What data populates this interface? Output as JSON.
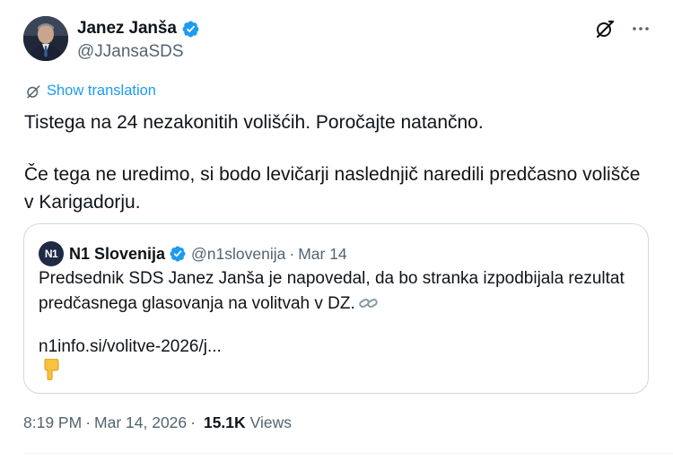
{
  "author": {
    "display_name": "Janez Janša",
    "handle": "@JJansaSDS"
  },
  "translate": {
    "label": "Show translation"
  },
  "post": {
    "line1": "Tistega na 24 nezakonitih volišćih. Poročajte natančno.",
    "line2": "Če tega ne uredimo, si bodo levičarji naslednjič naredili predčasno volišče v Karigadorju."
  },
  "quote": {
    "avatar_text": "N1",
    "name": "N1 Slovenija",
    "handle": "@n1slovenija",
    "separator": "·",
    "date": "Mar 14",
    "text": "Predsednik SDS Janez Janša je napovedal, da bo stranka izpodbijala rezultat predčasnega glasovanja na volitvah v DZ.",
    "link": "n1info.si/volitve-2026/j..."
  },
  "meta": {
    "time": "8:19 PM",
    "separator": "·",
    "date": "Mar 14, 2026",
    "separator2": "·",
    "views_count": "15.1K",
    "views_label": "Views"
  },
  "colors": {
    "accent": "#1d9bf0",
    "text": "#0f1419",
    "secondary": "#536471",
    "border": "#cfd9de"
  },
  "icons": {
    "verified": "verified-badge-icon",
    "grok": "grok-icon",
    "more": "more-icon",
    "translate": "translate-icon",
    "link": "link-emoji-icon",
    "point": "point-down-emoji-icon"
  }
}
